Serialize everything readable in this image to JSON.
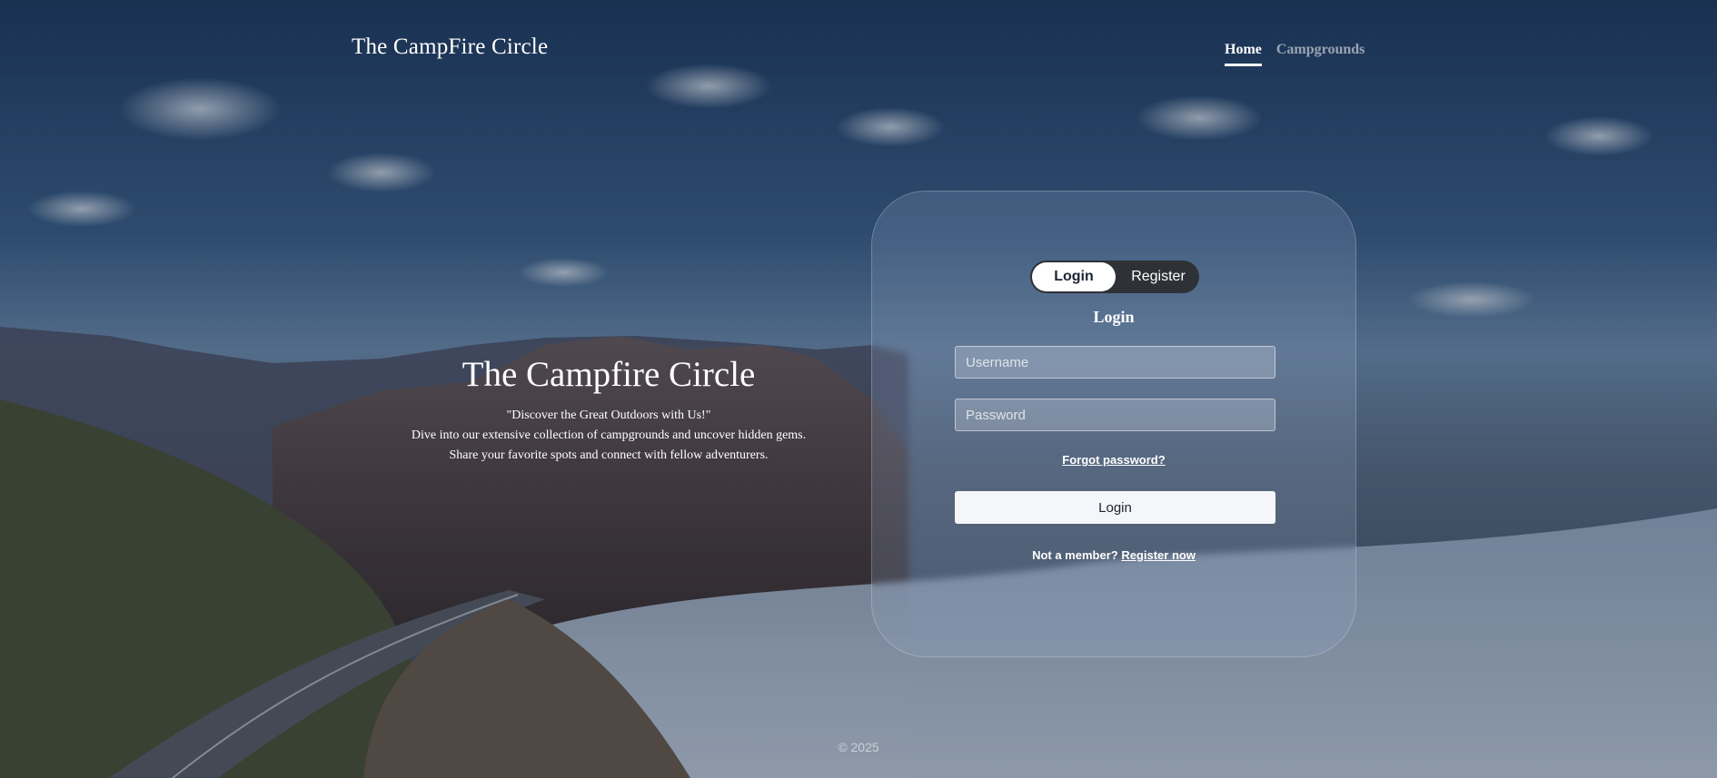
{
  "brand": {
    "title": "The CampFire Circle"
  },
  "nav": {
    "items": [
      {
        "label": "Home",
        "active": true
      },
      {
        "label": "Campgrounds",
        "active": false
      }
    ]
  },
  "hero": {
    "title": "The Campfire Circle",
    "tagline": "\"Discover the Great Outdoors with Us!\"",
    "line1": "Dive into our extensive collection of campgrounds and uncover hidden gems.",
    "line2": "Share your favorite spots and connect with fellow adventurers."
  },
  "auth": {
    "toggle": {
      "login": "Login",
      "register": "Register",
      "selected": "Login"
    },
    "form_title": "Login",
    "username": {
      "placeholder": "Username",
      "value": ""
    },
    "password": {
      "placeholder": "Password",
      "value": ""
    },
    "forgot_label": "Forgot password?",
    "submit_label": "Login",
    "signup_prompt": "Not a member?",
    "signup_link": "Register now"
  },
  "footer": {
    "text": "© 2025"
  },
  "colors": {
    "card_bg": "rgba(150,170,200,0.22)",
    "toggle_bg": "#2e3135",
    "button_bg": "#f4f6f9",
    "text": "#ffffff"
  }
}
